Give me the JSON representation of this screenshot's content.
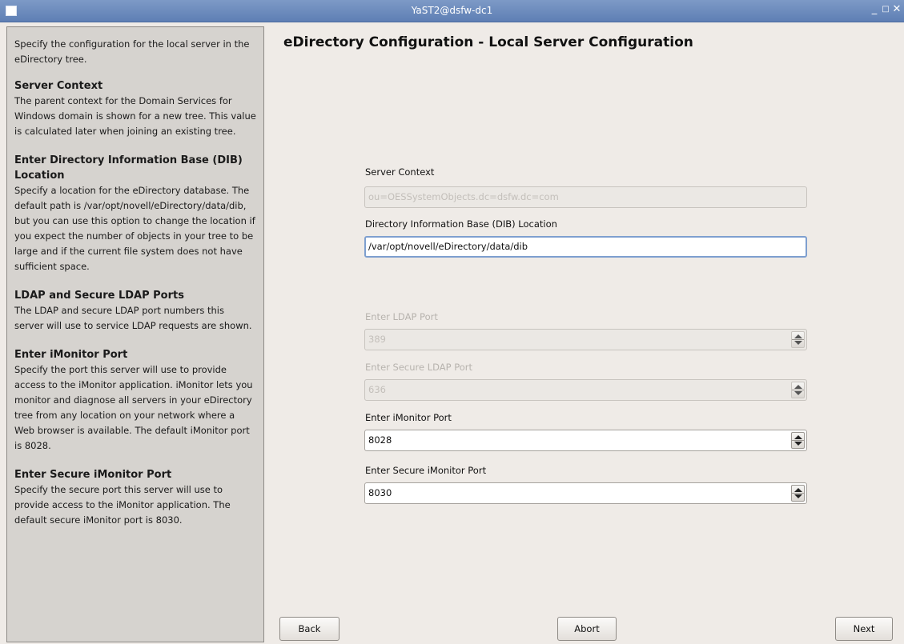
{
  "window": {
    "title": "YaST2@dsfw-dc1"
  },
  "help": {
    "intro": "Specify the configuration for the local server in the eDirectory tree.",
    "sections": [
      {
        "heading": "Server Context",
        "body": "The parent context for the Domain Services for Windows domain is shown for a new tree. This value is calculated later when joining an existing tree."
      },
      {
        "heading": "Enter Directory Information Base (DIB) Location",
        "body": "Specify a location for the eDirectory database. The default path is /var/opt/novell/eDirectory/data/dib, but you can use this option to change the location if you expect the number of objects in your tree to be large and if the current file system does not have sufficient space."
      },
      {
        "heading": "LDAP and Secure LDAP Ports",
        "body": "The LDAP and secure LDAP port numbers this server will use to service LDAP requests are shown."
      },
      {
        "heading": "Enter iMonitor Port",
        "body": "Specify the port this server will use to provide access to the iMonitor application. iMonitor lets you monitor and diagnose all servers in your eDirectory tree from any location on your network where a Web browser is available. The default iMonitor port is 8028."
      },
      {
        "heading": "Enter Secure iMonitor Port",
        "body": "Specify the secure port this server will use to provide access to the iMonitor application. The default secure iMonitor port is 8030."
      }
    ]
  },
  "main": {
    "title": "eDirectory Configuration - Local Server Configuration",
    "server_context": {
      "label": "Server Context",
      "value": "ou=OESSystemObjects.dc=dsfw.dc=com"
    },
    "dib_location": {
      "label": "Directory Information Base (DIB) Location",
      "value": "/var/opt/novell/eDirectory/data/dib"
    },
    "ldap_port": {
      "label": "Enter LDAP Port",
      "value": "389"
    },
    "secure_ldap_port": {
      "label": "Enter Secure LDAP Port",
      "value": "636"
    },
    "imonitor_port": {
      "label": "Enter iMonitor Port",
      "value": "8028"
    },
    "secure_imonitor_port": {
      "label": "Enter Secure iMonitor Port",
      "value": "8030"
    }
  },
  "buttons": {
    "back": "Back",
    "abort": "Abort",
    "next": "Next"
  }
}
